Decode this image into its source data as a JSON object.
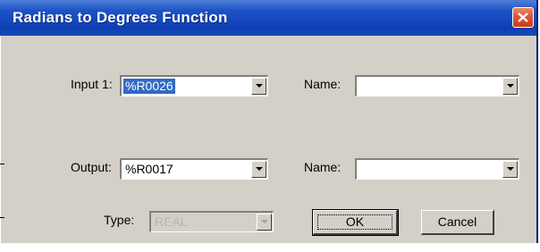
{
  "window": {
    "title": "Radians to Degrees Function"
  },
  "input1": {
    "label": "Input 1:",
    "value": "%R0026",
    "name_label": "Name:",
    "name_value": ""
  },
  "output": {
    "label": "Output:",
    "value": "%R0017",
    "name_label": "Name:",
    "name_value": ""
  },
  "type": {
    "label": "Type:",
    "value": "REAL"
  },
  "buttons": {
    "ok": "OK",
    "cancel": "Cancel"
  }
}
